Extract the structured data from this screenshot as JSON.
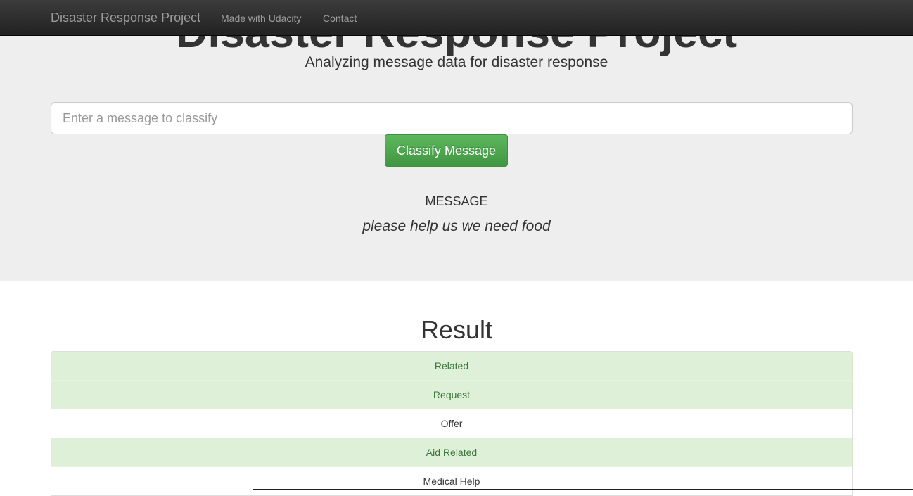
{
  "navbar": {
    "brand": "Disaster Response Project",
    "links": [
      "Made with Udacity",
      "Contact"
    ]
  },
  "jumbotron": {
    "title": "Disaster Response Project",
    "subtitle": "Analyzing message data for disaster response",
    "input_placeholder": "Enter a message to classify",
    "button_label": "Classify Message",
    "message_heading": "MESSAGE",
    "message_text": "please help us we need food"
  },
  "results": {
    "heading": "Result",
    "items": [
      {
        "label": "Related",
        "positive": true
      },
      {
        "label": "Request",
        "positive": true
      },
      {
        "label": "Offer",
        "positive": false
      },
      {
        "label": "Aid Related",
        "positive": true
      },
      {
        "label": "Medical Help",
        "positive": false
      }
    ]
  },
  "colors": {
    "navbar": "#222222",
    "jumbotron": "#eeeeee",
    "positive_bg": "#dff0d8",
    "positive_text": "#3c763d",
    "button": "#5cb85c"
  }
}
